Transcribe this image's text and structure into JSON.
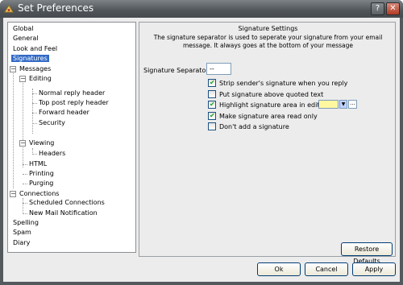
{
  "window": {
    "title": "Set Preferences"
  },
  "tree": {
    "items": [
      {
        "label": "Global",
        "level": 0,
        "selected": false
      },
      {
        "label": "General",
        "level": 0,
        "selected": false
      },
      {
        "label": "Look and Feel",
        "level": 0,
        "selected": false
      },
      {
        "label": "Signatures",
        "level": 0,
        "selected": true
      },
      {
        "label": "Messages",
        "level": 0,
        "expander": "minus"
      },
      {
        "label": "Editing",
        "level": 1,
        "expander": "minus"
      },
      {
        "label": "Normal reply header",
        "level": 2
      },
      {
        "label": "Top post reply header",
        "level": 2
      },
      {
        "label": "Forward header",
        "level": 2
      },
      {
        "label": "Security",
        "level": 2
      },
      {
        "label": "Viewing",
        "level": 1,
        "expander": "minus"
      },
      {
        "label": "Headers",
        "level": 2
      },
      {
        "label": "HTML",
        "level": 1
      },
      {
        "label": "Printing",
        "level": 1
      },
      {
        "label": "Purging",
        "level": 1
      },
      {
        "label": "Connections",
        "level": 0,
        "expander": "minus"
      },
      {
        "label": "Scheduled Connections",
        "level": 1
      },
      {
        "label": "New Mail Notification",
        "level": 1
      },
      {
        "label": "Spelling",
        "level": 0
      },
      {
        "label": "Spam",
        "level": 0
      },
      {
        "label": "Diary",
        "level": 0
      }
    ]
  },
  "panel": {
    "heading": "Signature Settings",
    "description": "The signature separator is used to seperate your signature from your email message.  It always goes at the bottom of your message",
    "separator_label": "Signature Separator:",
    "separator_value": "--",
    "options": [
      {
        "label": "Strip sender's signature when you reply",
        "checked": true
      },
      {
        "label": "Put signature above quoted text",
        "checked": false
      },
      {
        "label": "Highlight signature area in editor",
        "checked": true
      },
      {
        "label": "Make signature area read only",
        "checked": true
      },
      {
        "label": "Don't add a signature",
        "checked": false
      }
    ],
    "highlight_color": "#fff8a0",
    "color_more_label": "...",
    "restore_label": "Restore Defaults"
  },
  "buttons": {
    "ok": "Ok",
    "cancel": "Cancel",
    "apply": "Apply"
  }
}
